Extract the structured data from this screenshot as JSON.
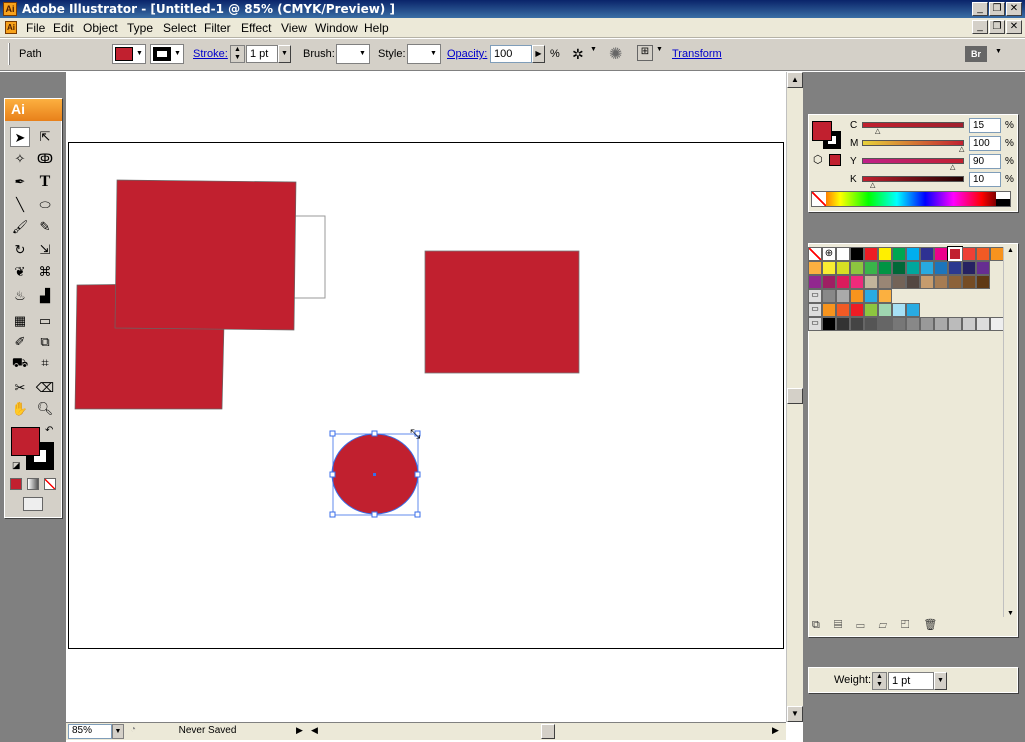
{
  "window": {
    "title": "Adobe Illustrator - [Untitled-1 @ 85% (CMYK/Preview) ]",
    "app_icon": "Ai"
  },
  "menu": [
    "File",
    "Edit",
    "Object",
    "Type",
    "Select",
    "Filter",
    "Effect",
    "View",
    "Window",
    "Help"
  ],
  "control": {
    "object_type": "Path",
    "stroke_label": "Stroke:",
    "stroke_value": "1 pt",
    "brush_label": "Brush:",
    "style_label": "Style:",
    "opacity_label": "Opacity:",
    "opacity_value": "100",
    "percent": "%",
    "transform_label": "Transform",
    "bridge_label": "Br"
  },
  "colors": {
    "fill": "#c1202f",
    "accent_link": "#0000cc",
    "selection": "#3a6ee8"
  },
  "toolbox": {
    "badge": "Ai",
    "tools": [
      "selection-icon",
      "direct-selection-icon",
      "magic-wand-icon",
      "lasso-icon",
      "pen-icon",
      "type-icon",
      "line-icon",
      "ellipse-icon",
      "paintbrush-icon",
      "pencil-icon",
      "rotate-icon",
      "scale-icon",
      "warp-icon",
      "free-transform-icon",
      "symbol-sprayer-icon",
      "column-graph-icon",
      "mesh-icon",
      "gradient-icon",
      "eyedropper-icon",
      "blend-icon",
      "live-paint-icon",
      "slice-icon",
      "scissors-icon",
      "eraser-icon",
      "hand-icon",
      "zoom-icon"
    ]
  },
  "color_panel": {
    "rows": [
      {
        "label": "C",
        "value": "15",
        "pct": "%"
      },
      {
        "label": "M",
        "value": "100",
        "pct": "%"
      },
      {
        "label": "Y",
        "value": "90",
        "pct": "%"
      },
      {
        "label": "K",
        "value": "10",
        "pct": "%"
      }
    ]
  },
  "stroke_panel": {
    "weight_label": "Weight:",
    "weight_value": "1 pt"
  },
  "status": {
    "zoom": "85%",
    "save_state": "Never Saved"
  }
}
